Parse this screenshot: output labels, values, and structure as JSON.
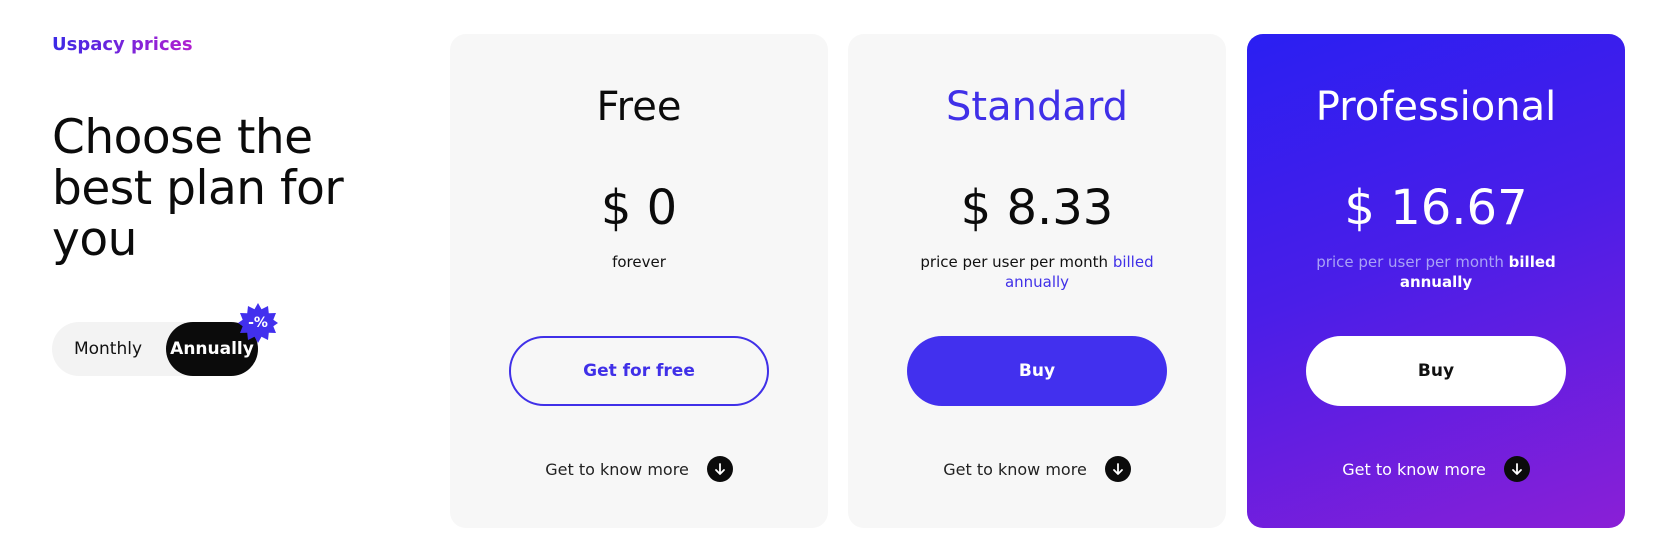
{
  "header": {
    "eyebrow": "Uspacy prices",
    "headline": "Choose the best plan for you"
  },
  "billing_toggle": {
    "monthly_label": "Monthly",
    "annually_label": "Annually",
    "selected": "Annually",
    "discount_badge": "-%"
  },
  "plans": [
    {
      "name": "Free",
      "price": "$ 0",
      "note": "forever",
      "cta": "Get for free",
      "more": "Get to know more"
    },
    {
      "name": "Standard",
      "price": "$ 8.33",
      "note_prefix": "price per user per month",
      "note_suffix": "billed annually",
      "cta": "Buy",
      "more": "Get to know more"
    },
    {
      "name": "Professional",
      "price": "$ 16.67",
      "note_prefix": "price per user per month",
      "note_suffix": "billed annually",
      "cta": "Buy",
      "more": "Get to know more"
    }
  ],
  "colors": {
    "accent": "#4030e8",
    "pro_gradient_start": "#2a1ff2",
    "pro_gradient_end": "#8a1fd6",
    "card_bg": "#f7f7f7",
    "dark": "#0b0b0b"
  }
}
